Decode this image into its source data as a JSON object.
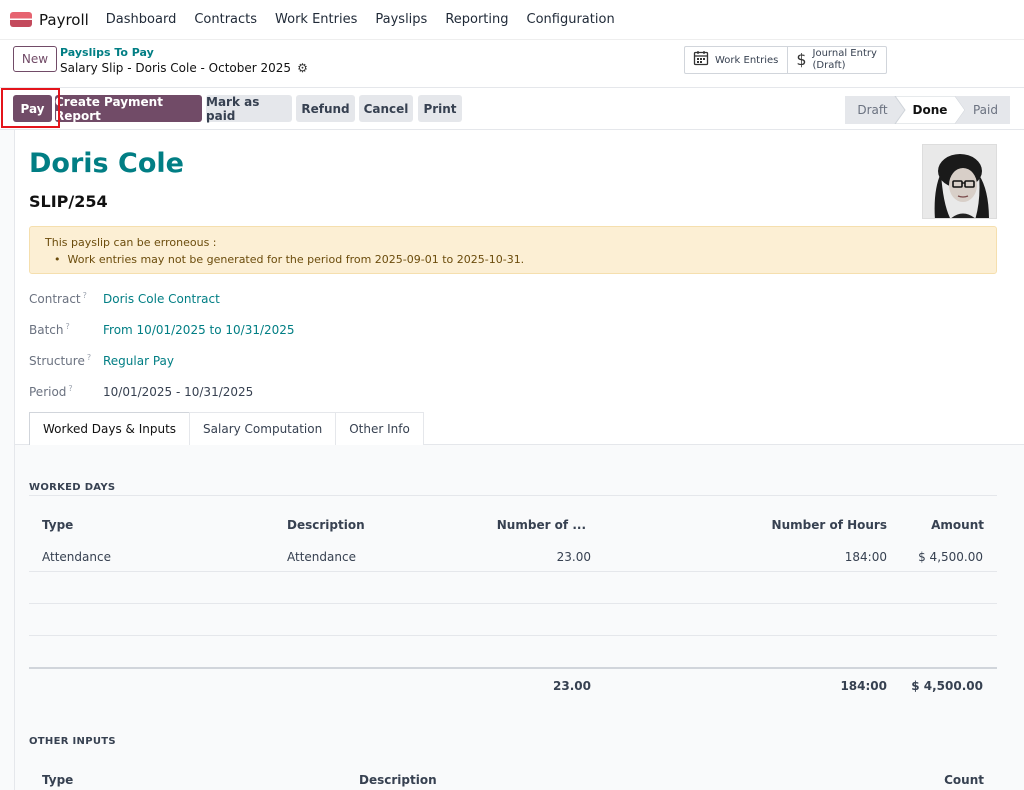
{
  "nav": {
    "brand": "Payroll",
    "menu": [
      "Dashboard",
      "Contracts",
      "Work Entries",
      "Payslips",
      "Reporting",
      "Configuration"
    ]
  },
  "control": {
    "new_label": "New",
    "breadcrumb_parent": "Payslips To Pay",
    "breadcrumb_current": "Salary Slip - Doris Cole - October 2025",
    "smart_work_entries": "Work Entries",
    "smart_journal_line1": "Journal Entry",
    "smart_journal_line2": "(Draft)"
  },
  "actions": {
    "pay": "Pay",
    "create_payment_report": "Create Payment Report",
    "mark_as_paid": "Mark as paid",
    "refund": "Refund",
    "cancel": "Cancel",
    "print": "Print"
  },
  "stages": [
    "Draft",
    "Done",
    "Paid"
  ],
  "active_stage": "Done",
  "sheet": {
    "employee_name": "Doris Cole",
    "slip_number": "SLIP/254",
    "alert_title": "This payslip can be erroneous :",
    "alert_item": "Work entries may not be generated for the period from 2025-09-01 to 2025-10-31.",
    "fields": {
      "contract_label": "Contract",
      "contract_value": "Doris Cole Contract",
      "batch_label": "Batch",
      "batch_value": "From 10/01/2025 to 10/31/2025",
      "structure_label": "Structure",
      "structure_value": "Regular Pay",
      "period_label": "Period",
      "period_value": "10/01/2025 - 10/31/2025",
      "help_mark": "?"
    }
  },
  "tabs": [
    "Worked Days & Inputs",
    "Salary Computation",
    "Other Info"
  ],
  "worked_days": {
    "title": "WORKED DAYS",
    "columns": [
      "Type",
      "Description",
      "Number of ...",
      "Number of Hours",
      "Amount"
    ],
    "rows": [
      {
        "type": "Attendance",
        "description": "Attendance",
        "days": "23.00",
        "hours": "184:00",
        "amount": "$ 4,500.00"
      }
    ],
    "totals": {
      "days": "23.00",
      "hours": "184:00",
      "amount": "$ 4,500.00"
    }
  },
  "other_inputs": {
    "title": "OTHER INPUTS",
    "columns": [
      "Type",
      "Description",
      "Count"
    ]
  },
  "colors": {
    "primary": "#714b67",
    "link": "#017e84",
    "highlight": "#e4141b"
  }
}
